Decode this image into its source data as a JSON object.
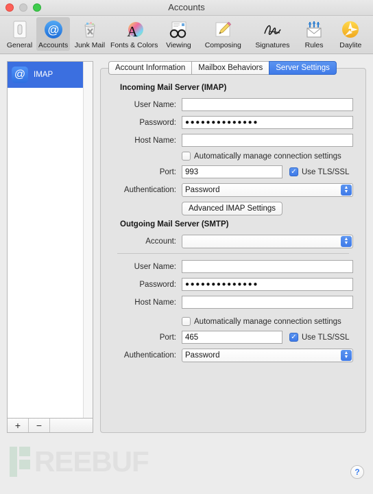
{
  "window": {
    "title": "Accounts",
    "traffic_lights": [
      "close",
      "minimize",
      "zoom"
    ]
  },
  "toolbar": {
    "items": [
      {
        "label": "General",
        "icon": "general-icon"
      },
      {
        "label": "Accounts",
        "icon": "accounts-at-icon"
      },
      {
        "label": "Junk Mail",
        "icon": "junk-mail-trash-icon"
      },
      {
        "label": "Fonts & Colors",
        "icon": "fonts-colors-icon"
      },
      {
        "label": "Viewing",
        "icon": "viewing-glasses-icon"
      },
      {
        "label": "Composing",
        "icon": "composing-pencil-icon"
      },
      {
        "label": "Signatures",
        "icon": "signatures-icon"
      },
      {
        "label": "Rules",
        "icon": "rules-envelope-icon"
      },
      {
        "label": "Daylite",
        "icon": "daylite-sun-icon"
      }
    ],
    "selected": "Accounts"
  },
  "account_list": {
    "accounts": [
      {
        "name": "IMAP",
        "icon": "at-sign-icon",
        "selected": true
      }
    ],
    "add_button": "+",
    "remove_button": "−"
  },
  "tabs": [
    {
      "label": "Account Information",
      "active": false
    },
    {
      "label": "Mailbox Behaviors",
      "active": false
    },
    {
      "label": "Server Settings",
      "active": true
    }
  ],
  "incoming": {
    "section_title": "Incoming Mail Server (IMAP)",
    "user_name_label": "User Name:",
    "user_name_value": "",
    "password_label": "Password:",
    "password_value": "●●●●●●●●●●●●●●",
    "host_name_label": "Host Name:",
    "host_name_value": "",
    "auto_manage_label": "Automatically manage connection settings",
    "auto_manage_checked": false,
    "port_label": "Port:",
    "port_value": "993",
    "tls_label": "Use TLS/SSL",
    "tls_checked": true,
    "authentication_label": "Authentication:",
    "authentication_value": "Password",
    "advanced_button": "Advanced IMAP Settings"
  },
  "outgoing": {
    "section_title": "Outgoing Mail Server (SMTP)",
    "account_label": "Account:",
    "account_value": "",
    "user_name_label": "User Name:",
    "user_name_value": "",
    "password_label": "Password:",
    "password_value": "●●●●●●●●●●●●●●",
    "host_name_label": "Host Name:",
    "host_name_value": "",
    "auto_manage_label": "Automatically manage connection settings",
    "auto_manage_checked": false,
    "port_label": "Port:",
    "port_value": "465",
    "tls_label": "Use TLS/SSL",
    "tls_checked": true,
    "authentication_label": "Authentication:",
    "authentication_value": "Password"
  },
  "footer": {
    "watermark": "REEBUF",
    "help_button": "?"
  },
  "colors": {
    "accent_blue": "#3f7ae8",
    "selection_blue": "#3b6fe0",
    "window_bg": "#ececec",
    "panel_bg": "#e4e4e4"
  }
}
